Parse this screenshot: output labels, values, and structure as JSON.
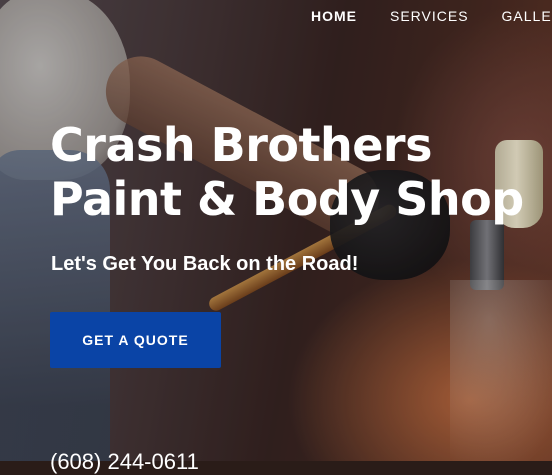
{
  "nav": {
    "items": [
      {
        "label": "HOME",
        "active": true
      },
      {
        "label": "SERVICES",
        "active": false
      },
      {
        "label": "GALLERY",
        "active": false
      }
    ]
  },
  "hero": {
    "title_line1": "Crash Brothers",
    "title_line2": "Paint & Body Shop",
    "tagline": "Let's Get You Back on the Road!",
    "cta_label": "GET A QUOTE",
    "phone": "(608) 244-0611"
  },
  "colors": {
    "cta_background": "#0a44a6",
    "text": "#ffffff"
  }
}
